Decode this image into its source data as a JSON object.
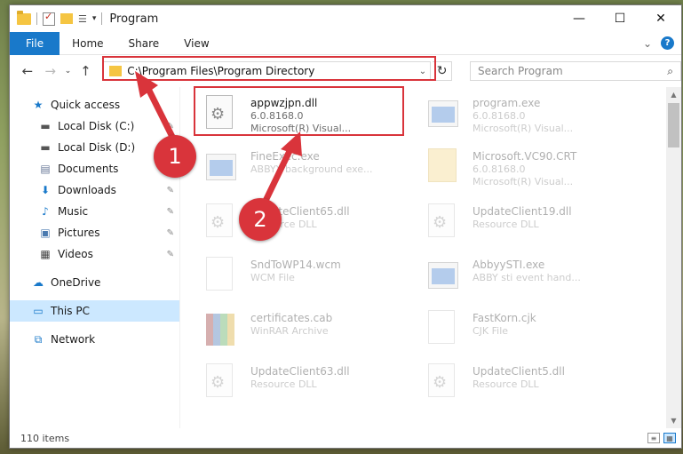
{
  "window": {
    "title": "Program",
    "min": "—",
    "max": "☐",
    "close": "✕"
  },
  "ribbon": {
    "tabs": [
      "File",
      "Home",
      "Share",
      "View"
    ],
    "collapse": "⌄",
    "help": "?"
  },
  "address": {
    "path": "C:\\Program Files\\Program Directory",
    "search_placeholder": "Search Program"
  },
  "nav": {
    "items": [
      {
        "label": "Quick access",
        "icon": "star-icon"
      },
      {
        "label": "Local Disk (C:)",
        "icon": "drive-icon"
      },
      {
        "label": "Local Disk (D:)",
        "icon": "drive-icon"
      },
      {
        "label": "Documents",
        "icon": "documents-icon"
      },
      {
        "label": "Downloads",
        "icon": "download-icon"
      },
      {
        "label": "Music",
        "icon": "music-icon"
      },
      {
        "label": "Pictures",
        "icon": "pictures-icon"
      },
      {
        "label": "Videos",
        "icon": "videos-icon"
      },
      {
        "label": "OneDrive",
        "icon": "cloud-icon"
      },
      {
        "label": "This PC",
        "icon": "computer-icon"
      },
      {
        "label": "Network",
        "icon": "network-icon"
      }
    ]
  },
  "files": [
    {
      "name": "appwzjpn.dll",
      "line2": "6.0.8168.0",
      "line3": "Microsoft(R) Visual..."
    },
    {
      "name": "program.exe",
      "line2": "6.0.8168.0",
      "line3": "Microsoft(R) Visual..."
    },
    {
      "name": "FineExec.exe",
      "line2": "ABBYY background exe...",
      "line3": ""
    },
    {
      "name": "Microsoft.VC90.CRT",
      "line2": "6.0.8168.0",
      "line3": "Microsoft(R) Visual..."
    },
    {
      "name": "UpdateClient65.dll",
      "line2": "Resource DLL",
      "line3": ""
    },
    {
      "name": "UpdateClient19.dll",
      "line2": "Resource DLL",
      "line3": ""
    },
    {
      "name": "SndToWP14.wcm",
      "line2": "WCM File",
      "line3": ""
    },
    {
      "name": "AbbyySTI.exe",
      "line2": "ABBY sti event hand...",
      "line3": ""
    },
    {
      "name": "certificates.cab",
      "line2": "WinRAR Archive",
      "line3": ""
    },
    {
      "name": "FastKorn.cjk",
      "line2": "CJK File",
      "line3": ""
    },
    {
      "name": "UpdateClient63.dll",
      "line2": "Resource DLL",
      "line3": ""
    },
    {
      "name": "UpdateClient5.dll",
      "line2": "Resource DLL",
      "line3": ""
    }
  ],
  "status": {
    "count": "110 items"
  },
  "annotations": {
    "step1": "1",
    "step2": "2"
  },
  "colors": {
    "accent": "#1979ca",
    "highlight": "#d9343b",
    "selected": "#cce8ff"
  }
}
